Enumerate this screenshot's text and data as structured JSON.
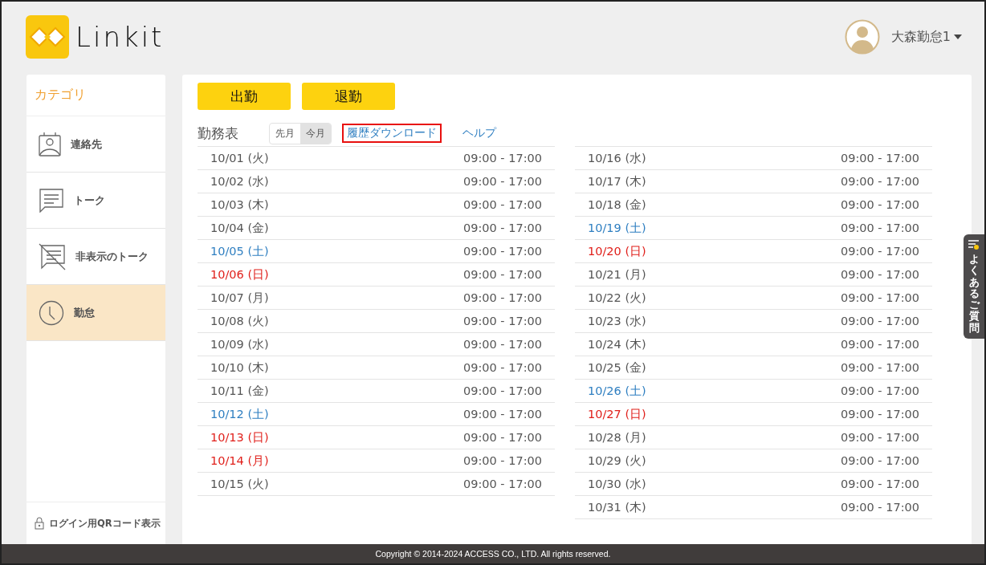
{
  "header": {
    "logo_text": "Linkit",
    "user_name": "大森勤怠1"
  },
  "sidebar": {
    "title": "カテゴリ",
    "items": [
      {
        "label": "連絡先",
        "kind": "contact",
        "selected": false
      },
      {
        "label": "トーク",
        "kind": "talk",
        "selected": false
      },
      {
        "label": "非表示のトーク",
        "kind": "hidden",
        "selected": false
      },
      {
        "label": "勤怠",
        "kind": "attendance",
        "selected": true
      }
    ],
    "footer_link": "ログイン用QRコード表示"
  },
  "actions": [
    "出勤",
    "退勤"
  ],
  "timesheet": {
    "title": "勤務表",
    "month_tabs": [
      {
        "label": "先月",
        "selected": false
      },
      {
        "label": "今月",
        "selected": true
      }
    ],
    "links": [
      {
        "label": "履歴ダウンロード",
        "highlighted": true
      },
      {
        "label": "ヘルプ",
        "highlighted": false
      }
    ],
    "columns": [
      [
        {
          "date": "10/01 (火)",
          "time": "09:00 - 17:00",
          "kind": "weekday"
        },
        {
          "date": "10/02 (水)",
          "time": "09:00 - 17:00",
          "kind": "weekday"
        },
        {
          "date": "10/03 (木)",
          "time": "09:00 - 17:00",
          "kind": "weekday"
        },
        {
          "date": "10/04 (金)",
          "time": "09:00 - 17:00",
          "kind": "weekday"
        },
        {
          "date": "10/05 (土)",
          "time": "09:00 - 17:00",
          "kind": "saturday"
        },
        {
          "date": "10/06 (日)",
          "time": "09:00 - 17:00",
          "kind": "holiday"
        },
        {
          "date": "10/07 (月)",
          "time": "09:00 - 17:00",
          "kind": "weekday"
        },
        {
          "date": "10/08 (火)",
          "time": "09:00 - 17:00",
          "kind": "weekday"
        },
        {
          "date": "10/09 (水)",
          "time": "09:00 - 17:00",
          "kind": "weekday"
        },
        {
          "date": "10/10 (木)",
          "time": "09:00 - 17:00",
          "kind": "weekday"
        },
        {
          "date": "10/11 (金)",
          "time": "09:00 - 17:00",
          "kind": "weekday"
        },
        {
          "date": "10/12 (土)",
          "time": "09:00 - 17:00",
          "kind": "saturday"
        },
        {
          "date": "10/13 (日)",
          "time": "09:00 - 17:00",
          "kind": "holiday"
        },
        {
          "date": "10/14 (月)",
          "time": "09:00 - 17:00",
          "kind": "holiday"
        },
        {
          "date": "10/15 (火)",
          "time": "09:00 - 17:00",
          "kind": "weekday"
        }
      ],
      [
        {
          "date": "10/16 (水)",
          "time": "09:00 - 17:00",
          "kind": "weekday"
        },
        {
          "date": "10/17 (木)",
          "time": "09:00 - 17:00",
          "kind": "weekday"
        },
        {
          "date": "10/18 (金)",
          "time": "09:00 - 17:00",
          "kind": "weekday"
        },
        {
          "date": "10/19 (土)",
          "time": "09:00 - 17:00",
          "kind": "saturday"
        },
        {
          "date": "10/20 (日)",
          "time": "09:00 - 17:00",
          "kind": "holiday"
        },
        {
          "date": "10/21 (月)",
          "time": "09:00 - 17:00",
          "kind": "weekday"
        },
        {
          "date": "10/22 (火)",
          "time": "09:00 - 17:00",
          "kind": "weekday"
        },
        {
          "date": "10/23 (水)",
          "time": "09:00 - 17:00",
          "kind": "weekday"
        },
        {
          "date": "10/24 (木)",
          "time": "09:00 - 17:00",
          "kind": "weekday"
        },
        {
          "date": "10/25 (金)",
          "time": "09:00 - 17:00",
          "kind": "weekday"
        },
        {
          "date": "10/26 (土)",
          "time": "09:00 - 17:00",
          "kind": "saturday"
        },
        {
          "date": "10/27 (日)",
          "time": "09:00 - 17:00",
          "kind": "holiday"
        },
        {
          "date": "10/28 (月)",
          "time": "09:00 - 17:00",
          "kind": "weekday"
        },
        {
          "date": "10/29 (火)",
          "time": "09:00 - 17:00",
          "kind": "weekday"
        },
        {
          "date": "10/30 (水)",
          "time": "09:00 - 17:00",
          "kind": "weekday"
        },
        {
          "date": "10/31 (木)",
          "time": "09:00 - 17:00",
          "kind": "weekday"
        }
      ]
    ]
  },
  "faq_tab": {
    "label": "よくあるご質問"
  },
  "footer": {
    "copyright": "Copyright © 2014-2024 ACCESS CO., LTD. All rights reserved."
  }
}
